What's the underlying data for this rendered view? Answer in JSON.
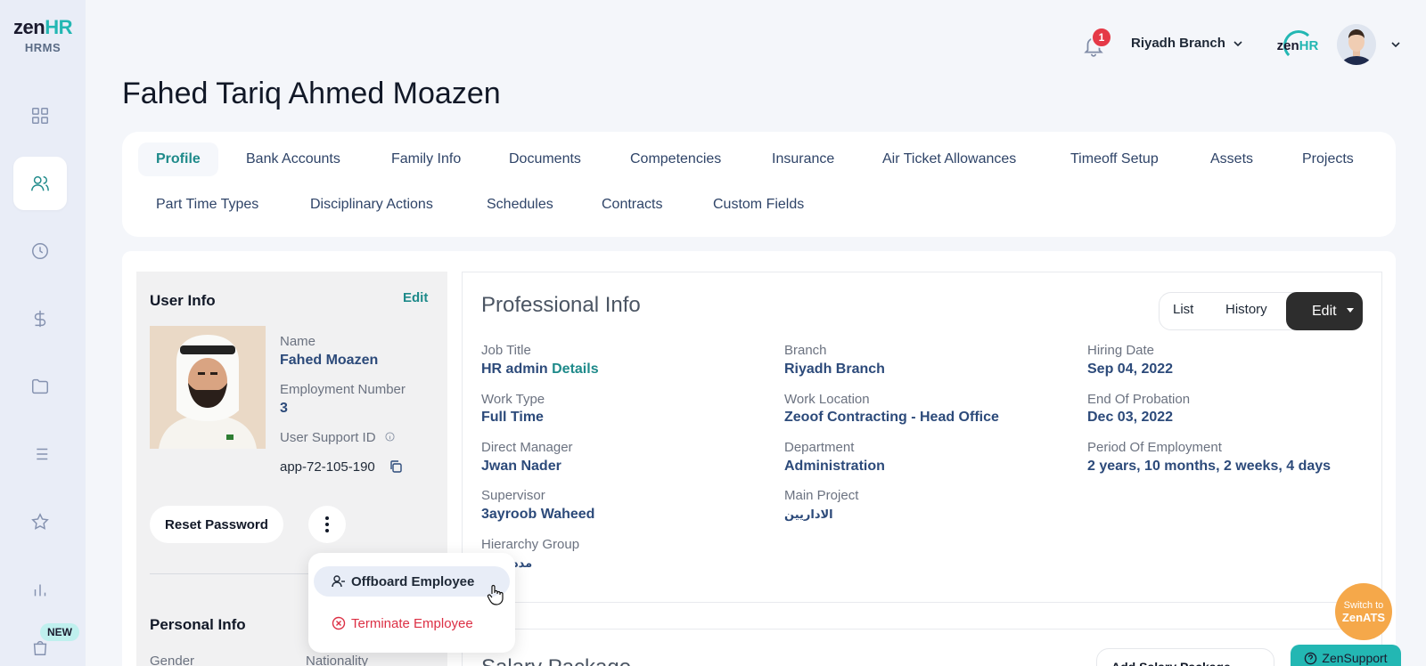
{
  "brand": {
    "logo_main": "zen",
    "logo_accent": "HR",
    "logo_sub": "HRMS",
    "accent_color": "#1e8a8a"
  },
  "sidebar": {
    "items": [
      {
        "icon": "dashboard-icon"
      },
      {
        "icon": "users-icon",
        "active": true
      },
      {
        "icon": "clock-icon"
      },
      {
        "icon": "dollar-icon"
      },
      {
        "icon": "folder-icon"
      },
      {
        "icon": "list-icon"
      },
      {
        "icon": "star-icon"
      },
      {
        "icon": "chart-icon"
      },
      {
        "icon": "bag-icon"
      }
    ],
    "new_badge": "NEW"
  },
  "header": {
    "notification_count": "1",
    "branch": "Riyadh Branch",
    "company_logo_main": "zen",
    "company_logo_accent": "HR"
  },
  "page_title": "Fahed Tariq Ahmed Moazen",
  "tabs": [
    "Profile",
    "Bank Accounts",
    "Family Info",
    "Documents",
    "Competencies",
    "Insurance",
    "Air Ticket Allowances",
    "Timeoff Setup",
    "Assets",
    "Projects",
    "Part Time Types",
    "Disciplinary Actions",
    "Schedules",
    "Contracts",
    "Custom Fields"
  ],
  "user_info": {
    "title": "User Info",
    "edit": "Edit",
    "name_label": "Name",
    "name": "Fahed Moazen",
    "employment_number_label": "Employment Number",
    "employment_number": "3",
    "support_id_label": "User Support ID",
    "support_id": "app-72-105-190",
    "reset_password": "Reset Password"
  },
  "menu": {
    "offboard": "Offboard Employee",
    "terminate": "Terminate Employee"
  },
  "personal_info": {
    "title": "Personal Info",
    "gender_label": "Gender",
    "nationality_label": "Nationality"
  },
  "professional_info": {
    "title": "Professional Info",
    "list": "List",
    "history": "History",
    "edit": "Edit",
    "job_title_label": "Job Title",
    "job_title": "HR admin",
    "details": "Details",
    "branch_label": "Branch",
    "branch": "Riyadh Branch",
    "hiring_date_label": "Hiring Date",
    "hiring_date": "Sep 04, 2022",
    "work_type_label": "Work Type",
    "work_type": "Full Time",
    "work_location_label": "Work Location",
    "work_location": "Zeoof Contracting - Head Office",
    "end_probation_label": "End Of Probation",
    "end_probation": "Dec 03, 2022",
    "direct_manager_label": "Direct Manager",
    "direct_manager": "Jwan Nader",
    "department_label": "Department",
    "department": "Administration",
    "period_label": "Period Of Employment",
    "period": "2 years, 10 months, 2 weeks, 4 days",
    "supervisor_label": "Supervisor",
    "supervisor": "3ayroob Waheed",
    "main_project_label": "Main Project",
    "main_project": "الاداريين",
    "hierarchy_label": "Hierarchy Group",
    "hierarchy": "مدد"
  },
  "salary": {
    "title": "Salary Package",
    "add_button": "Add Salary Package"
  },
  "floating": {
    "switch_small": "Switch to",
    "switch_big": "ZenATS",
    "support": "ZenSupport"
  }
}
